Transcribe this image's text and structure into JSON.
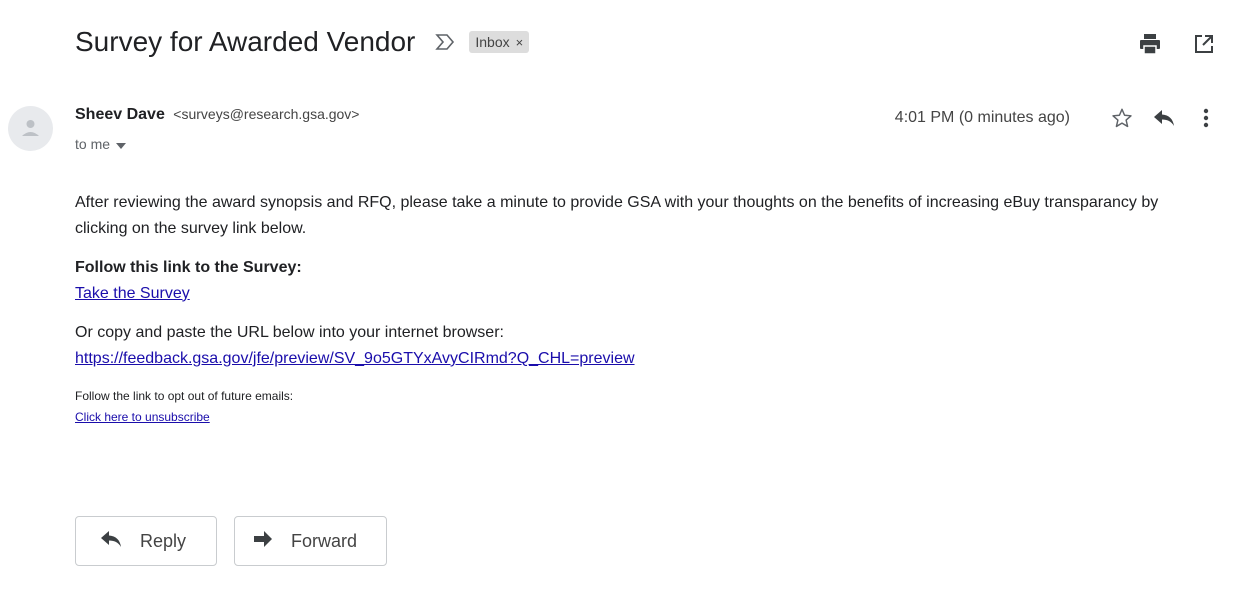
{
  "email": {
    "subject": "Survey for Awarded Vendor",
    "label": "Inbox",
    "label_close": "×",
    "sender_name": "Sheev Dave",
    "sender_email": "<surveys@research.gsa.gov>",
    "recipient": "to me",
    "timestamp": "4:01 PM (0 minutes ago)",
    "body": {
      "paragraph1": "After reviewing the award synopsis and RFQ, please take a minute to provide GSA with your thoughts on the benefits of increasing eBuy transparancy by clicking on the survey link below.",
      "follow_heading": "Follow this link to the Survey:",
      "survey_link": "Take the Survey",
      "copy_text": "Or copy and paste the URL below into your internet browser:",
      "url": "https://feedback.gsa.gov/jfe/preview/SV_9o5GTYxAvyCIRmd?Q_CHL=preview",
      "opt_out_text": "Follow the link to opt out of future emails:",
      "unsubscribe_link": "Click here to unsubscribe"
    }
  },
  "actions": {
    "reply_label": "Reply",
    "forward_label": "Forward"
  },
  "icons": {
    "importance": "importance-marker-icon",
    "print": "print-icon",
    "new_window": "open-in-new-window-icon",
    "star": "star-icon",
    "reply": "reply-icon",
    "more": "more-vert-icon",
    "dropdown": "caret-down-icon",
    "forward": "forward-icon",
    "avatar": "avatar-person-icon"
  }
}
